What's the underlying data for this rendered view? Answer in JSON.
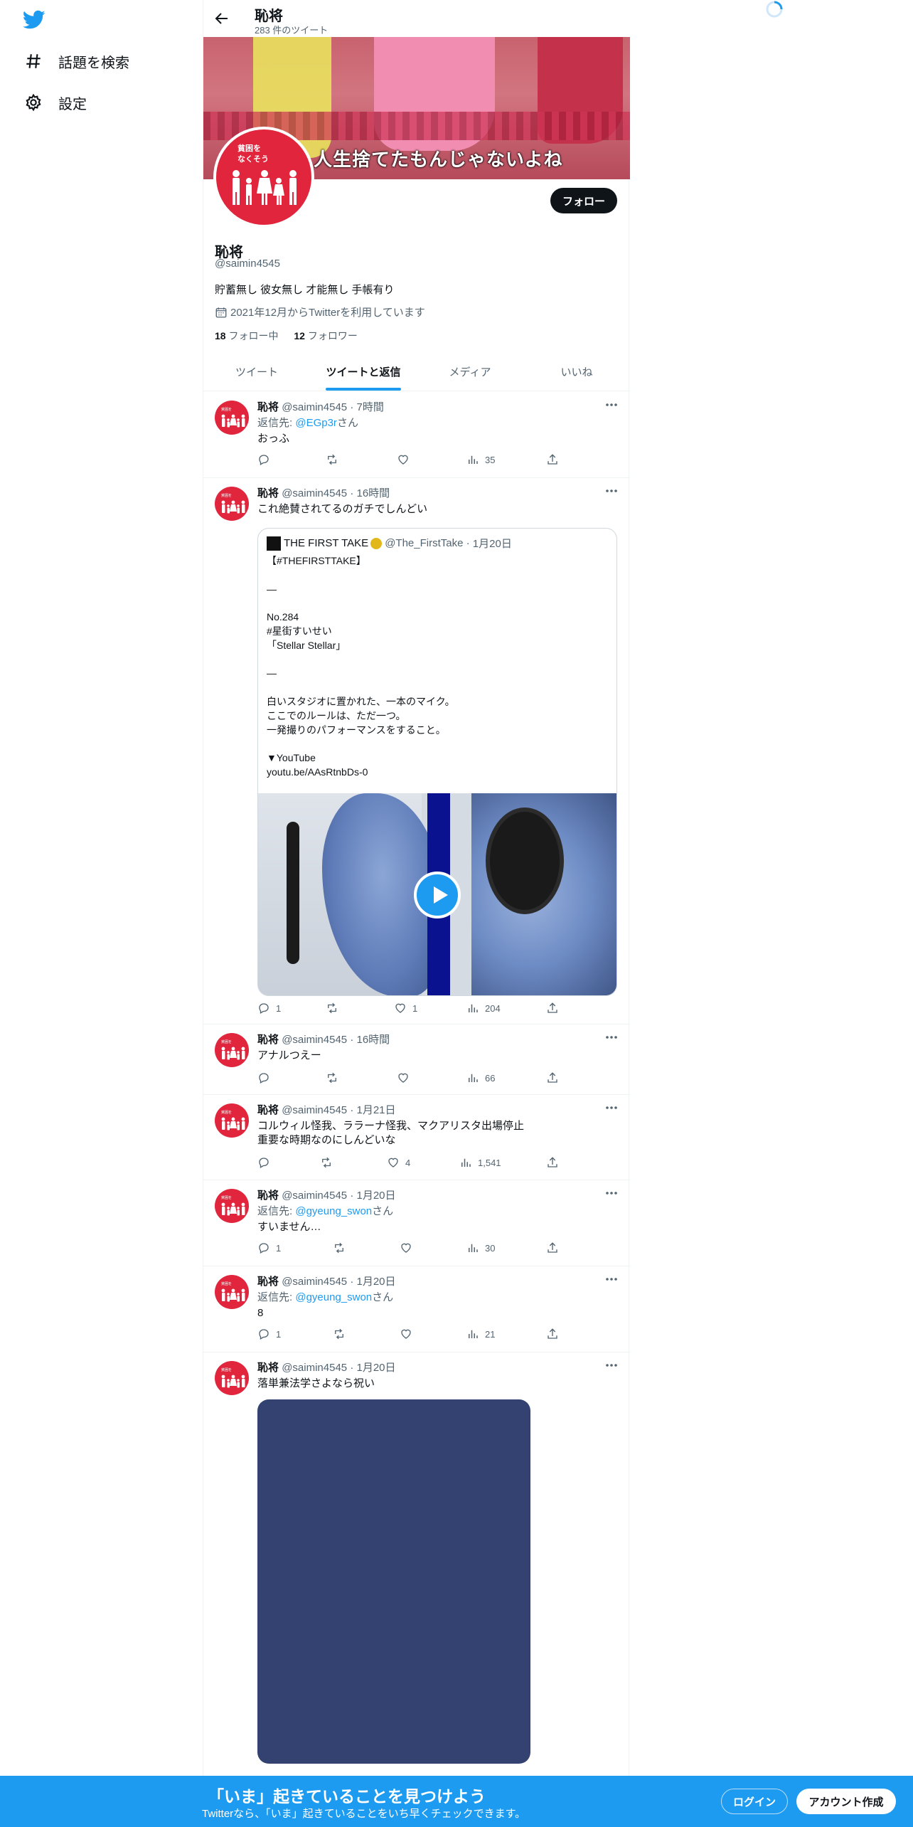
{
  "nav": {
    "items": [
      {
        "label": "話題を検索",
        "icon": "hashtag-icon"
      },
      {
        "label": "設定",
        "icon": "gear-icon"
      }
    ]
  },
  "header": {
    "title": "恥将",
    "tweet_count": "283 件のツイート"
  },
  "banner": {
    "caption": "人生捨てたもんじゃないよね"
  },
  "avatar": {
    "text_line1": "貧困を",
    "text_line2": "なくそう"
  },
  "profile": {
    "follow_label": "フォロー",
    "name": "恥将",
    "handle": "@saimin4545",
    "bio": "貯蓄無し 彼女無し 才能無し 手帳有り",
    "joined": "2021年12月からTwitterを利用しています",
    "following_count": "18",
    "following_label": "フォロー中",
    "followers_count": "12",
    "followers_label": "フォロワー"
  },
  "tabs": [
    {
      "label": "ツイート",
      "active": false
    },
    {
      "label": "ツイートと返信",
      "active": true
    },
    {
      "label": "メディア",
      "active": false
    },
    {
      "label": "いいね",
      "active": false
    }
  ],
  "tweets": [
    {
      "name": "恥将",
      "handle": "@saimin4545",
      "time": "7時間",
      "reply_prefix": "返信先: ",
      "reply_to": "@EGp3r",
      "reply_suffix": "さん",
      "text": "おっふ",
      "replies": "",
      "retweets": "",
      "likes": "",
      "views": "35"
    },
    {
      "name": "恥将",
      "handle": "@saimin4545",
      "time": "16時間",
      "text": "これ絶賛されてるのガチでしんどい",
      "quote": {
        "name": "THE FIRST TAKE",
        "handle": "@The_FirstTake",
        "time": "1月20日",
        "text": "【#THEFIRSTTAKE】\n\n―\n\nNo.284\n#星街すいせい\n「Stellar Stellar」\n\n―\n\n白いスタジオに置かれた、一本のマイク。\nここでのルールは、ただ一つ。\n一発撮りのパフォーマンスをすること。\n\n▼YouTube\nyoutu.be/AAsRtnbDs-0"
      },
      "replies": "1",
      "retweets": "",
      "likes": "1",
      "views": "204"
    },
    {
      "name": "恥将",
      "handle": "@saimin4545",
      "time": "16時間",
      "text": "アナルつえー",
      "replies": "",
      "retweets": "",
      "likes": "",
      "views": "66"
    },
    {
      "name": "恥将",
      "handle": "@saimin4545",
      "time": "1月21日",
      "text_line1": "コルウィル怪我、ララーナ怪我、マクアリスタ出場停止",
      "text_line2": "重要な時期なのにしんどいな",
      "replies": "",
      "retweets": "",
      "likes": "4",
      "views": "1,541"
    },
    {
      "name": "恥将",
      "handle": "@saimin4545",
      "time": "1月20日",
      "reply_prefix": "返信先: ",
      "reply_to": "@gyeung_swon",
      "reply_suffix": "さん",
      "text": "すいません…",
      "replies": "1",
      "retweets": "",
      "likes": "",
      "views": "30"
    },
    {
      "name": "恥将",
      "handle": "@saimin4545",
      "time": "1月20日",
      "reply_prefix": "返信先: ",
      "reply_to": "@gyeung_swon",
      "reply_suffix": "さん",
      "text": "8",
      "replies": "1",
      "retweets": "",
      "likes": "",
      "views": "21"
    },
    {
      "name": "恥将",
      "handle": "@saimin4545",
      "time": "1月20日",
      "text": "落単兼法学さよなら祝い"
    }
  ],
  "bottom_bar": {
    "title": "「いま」起きていることを見つけよう",
    "subtitle": "Twitterなら、「いま」起きていることをいち早くチェックできます。",
    "login": "ログイン",
    "signup": "アカウント作成"
  },
  "colors": {
    "accent": "#1d9bf0",
    "avatar_red": "#e1253d",
    "text": "#0f1419",
    "muted": "#536471"
  }
}
